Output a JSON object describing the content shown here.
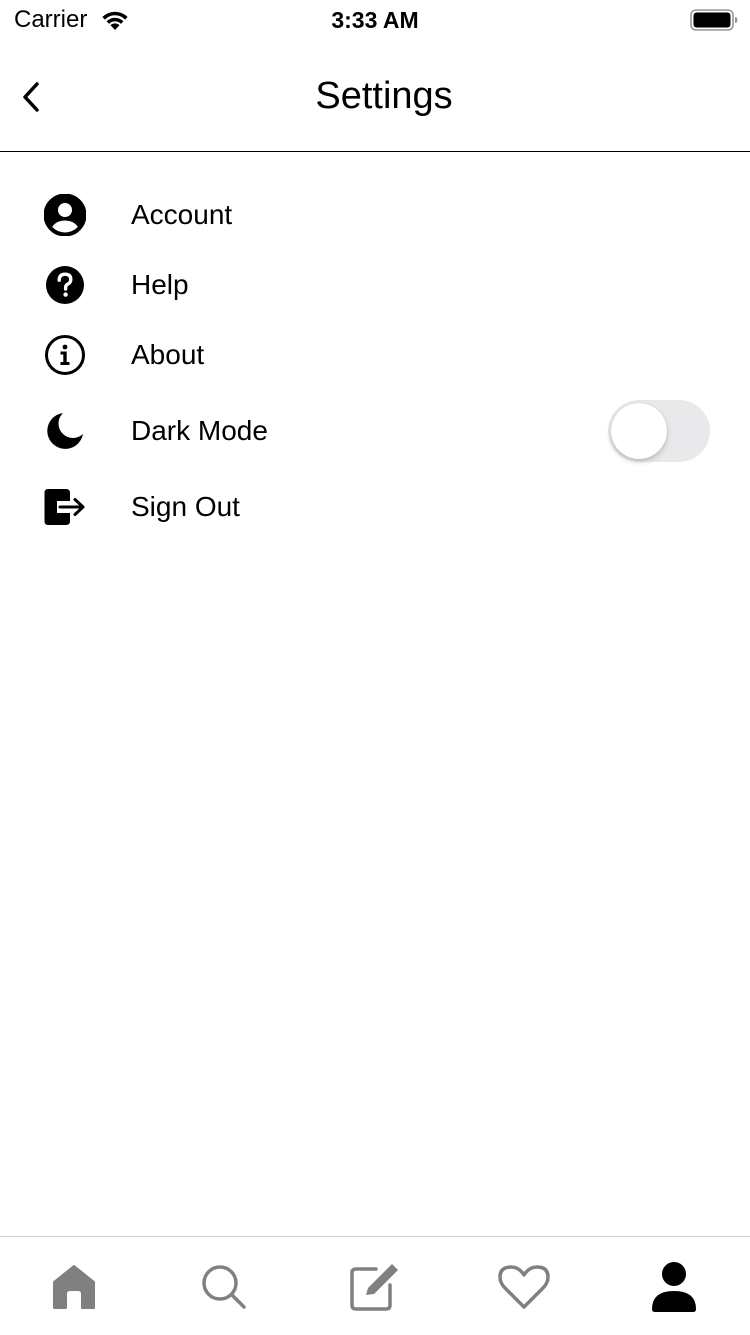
{
  "status_bar": {
    "carrier": "Carrier",
    "time": "3:33 AM"
  },
  "nav": {
    "title": "Settings"
  },
  "settings": {
    "items": [
      {
        "label": "Account",
        "icon": "account-circle-icon"
      },
      {
        "label": "Help",
        "icon": "question-circle-icon"
      },
      {
        "label": "About",
        "icon": "info-circle-icon"
      },
      {
        "label": "Dark Mode",
        "icon": "moon-icon",
        "toggle": false
      },
      {
        "label": "Sign Out",
        "icon": "sign-out-icon"
      }
    ]
  },
  "tab_bar": {
    "tabs": [
      {
        "name": "home",
        "icon": "home-icon"
      },
      {
        "name": "search",
        "icon": "search-icon"
      },
      {
        "name": "compose",
        "icon": "compose-icon"
      },
      {
        "name": "likes",
        "icon": "heart-icon"
      },
      {
        "name": "profile",
        "icon": "profile-icon",
        "active": true
      }
    ]
  },
  "colors": {
    "active_tab": "#000000",
    "inactive_tab": "#808080",
    "toggle_off": "#e9e9eb"
  }
}
